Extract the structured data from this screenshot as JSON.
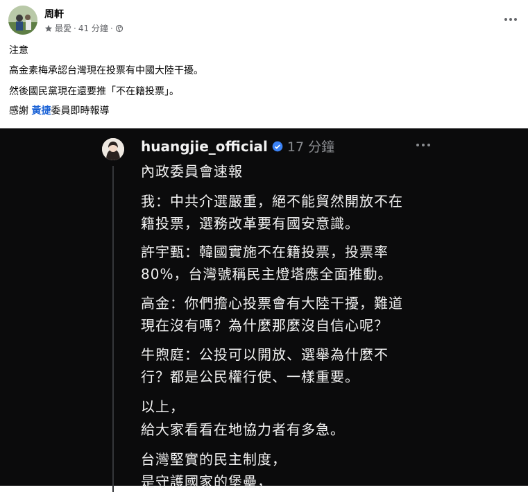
{
  "post": {
    "author": "周軒",
    "meta_label": "最愛",
    "meta_sep1": "·",
    "meta_time": "41 分鐘",
    "meta_sep2": "·",
    "lines": [
      "注意",
      "高金素梅承認台灣現在投票有中國大陸干擾。",
      "然後國民黨現在還要推「不在籍投票」。"
    ],
    "thanks_prefix": "感謝 ",
    "thanks_mention": "黃捷",
    "thanks_suffix": "委員即時報導"
  },
  "screenshot": {
    "username": "huangjie_official",
    "time": "17 分鐘",
    "lines": [
      "內政委員會速報",
      "我：中共介選嚴重，絕不能貿然開放不在",
      "籍投票，選務改革要有國安意識。",
      "許宇甄：韓國實施不在籍投票，投票率",
      "80%，台灣號稱民主燈塔應全面推動。",
      "高金：你們擔心投票會有大陸干擾，難道",
      "現在沒有嗎？為什麼那麼沒自信心呢？",
      "牛煦庭：公投可以開放、選舉為什麼不",
      "行？都是公民權行使、一樣重要。",
      "以上，",
      "給大家看看在地協力者有多急。",
      "台灣堅實的民主制度，",
      "是守護國家的堡壘，"
    ]
  },
  "colors": {
    "mention": "#1a62d6",
    "verified": "#3b82f6",
    "dark_bg": "#0b0b0c"
  }
}
